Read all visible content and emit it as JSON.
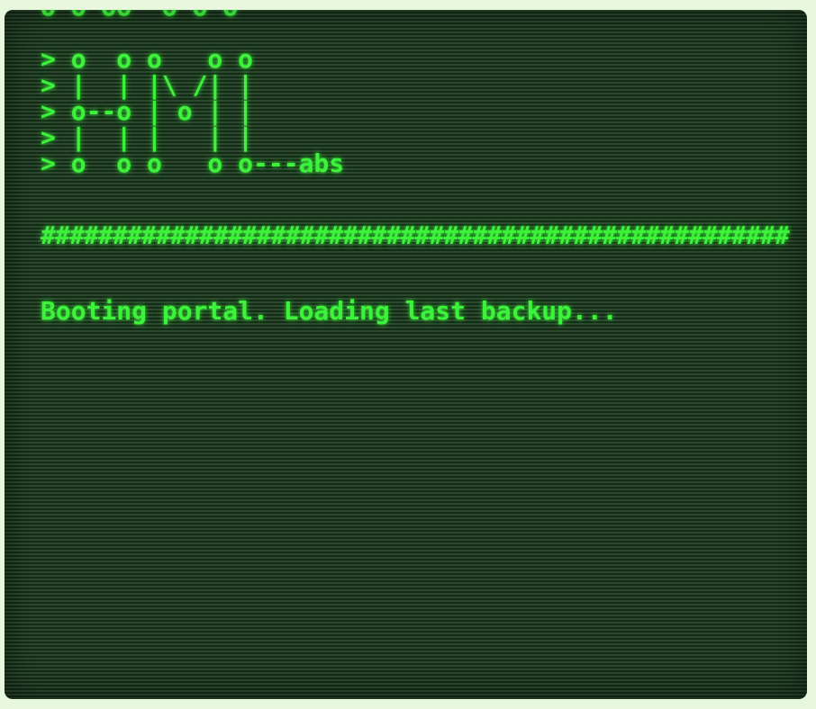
{
  "terminal": {
    "cut_off_line": "o o oo  o o o",
    "ascii_art": [
      "> o  o o   o o",
      "> |  | |\\ /| |",
      "> o--o | o | |",
      "> |  | |   | |",
      "> o  o o   o o---abs"
    ],
    "divider": "####################################################",
    "status_message": "Booting portal. Loading last backup..."
  },
  "colors": {
    "phosphor_green": "#3df23a",
    "screen_background": "#1f3a22",
    "page_background": "#e8f8dc"
  }
}
